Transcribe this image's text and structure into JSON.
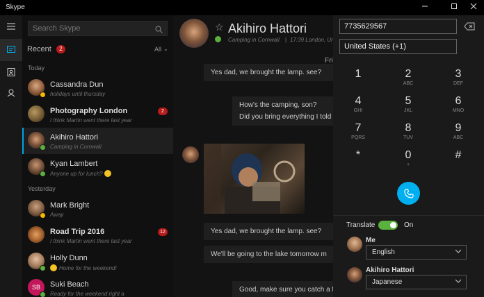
{
  "window": {
    "title": "Skype",
    "controls": [
      "minimize",
      "maximize",
      "close"
    ]
  },
  "rail": {
    "items": [
      {
        "icon": "menu-icon"
      },
      {
        "icon": "recent-chats-icon",
        "active": true
      },
      {
        "icon": "contacts-icon"
      },
      {
        "icon": "bots-icon"
      }
    ]
  },
  "contacts": {
    "search_placeholder": "Search Skype",
    "recent_label": "Recent",
    "recent_count": "2",
    "filter_label": "All",
    "sections": [
      {
        "label": "Today"
      },
      {
        "label": "Yesterday"
      }
    ],
    "items": [
      {
        "name": "Cassandra Dun",
        "status": "holidays until thursday",
        "bold": false,
        "badge": "",
        "presence": "#f5b800"
      },
      {
        "name": "Photography London",
        "status": "I think Martin went there last year",
        "bold": true,
        "badge": "2",
        "presence": ""
      },
      {
        "name": "Akihiro Hattori",
        "status": "Camping in Cornwall",
        "bold": false,
        "badge": "",
        "presence": "#5bb13d",
        "selected": true
      },
      {
        "name": "Kyan Lambert",
        "status": "Anyone up for lunch?",
        "bold": false,
        "badge": "",
        "presence": "#5bb13d",
        "emoji": true
      },
      {
        "name": "Mark Bright",
        "status": "Away",
        "bold": false,
        "badge": "",
        "presence": "#f5b800"
      },
      {
        "name": "Road Trip 2016",
        "status": "I think Martin went there last year",
        "bold": true,
        "badge": "12",
        "presence": ""
      },
      {
        "name": "Holly Dunn",
        "status": "Home for the weekend!",
        "bold": false,
        "badge": "",
        "presence": "#5bb13d",
        "emoji_leading": true
      },
      {
        "name": "Suki Beach",
        "status": "Ready for the weekend right a",
        "bold": false,
        "badge": "",
        "presence": "#5bb13d",
        "initials": "SB"
      }
    ]
  },
  "conversation": {
    "name": "Akihiro Hattori",
    "status": "Camping in Cornwall",
    "time": "17:39 London, Ur",
    "day_label": "Fri",
    "messages": [
      {
        "text": "Yes dad, we brought the lamp. see?",
        "side": "left"
      },
      {
        "text": "How's the camping, son?",
        "side": "right"
      },
      {
        "text": "Did you bring everything I told you?",
        "side": "right"
      },
      {
        "text": "Yes dad, we brought the lamp. see?",
        "side": "left"
      },
      {
        "text": "We'll be going to the lake tomorrow m",
        "side": "left"
      },
      {
        "text": "Good, make sure you catch a f",
        "side": "right"
      }
    ]
  },
  "dialpad": {
    "number": "7735629567",
    "country": "United States (+1)",
    "keys": [
      {
        "digit": "1",
        "letters": ""
      },
      {
        "digit": "2",
        "letters": "ABC"
      },
      {
        "digit": "3",
        "letters": "DEF"
      },
      {
        "digit": "4",
        "letters": "GHI"
      },
      {
        "digit": "5",
        "letters": "JKL"
      },
      {
        "digit": "6",
        "letters": "MNO"
      },
      {
        "digit": "7",
        "letters": "PQRS"
      },
      {
        "digit": "8",
        "letters": "TUV"
      },
      {
        "digit": "9",
        "letters": "ABC"
      },
      {
        "digit": "*",
        "letters": ""
      },
      {
        "digit": "0",
        "letters": "+"
      },
      {
        "digit": "#",
        "letters": ""
      }
    ],
    "translate_label": "Translate",
    "translate_state": "On",
    "translate_on": true,
    "participants": [
      {
        "name": "Me",
        "language": "English"
      },
      {
        "name": "Akihiro Hattori",
        "language": "Japanese"
      }
    ]
  },
  "colors": {
    "accent": "#00aff0",
    "online": "#5bb13d",
    "away": "#f5b800",
    "badge": "#b71c1c"
  }
}
